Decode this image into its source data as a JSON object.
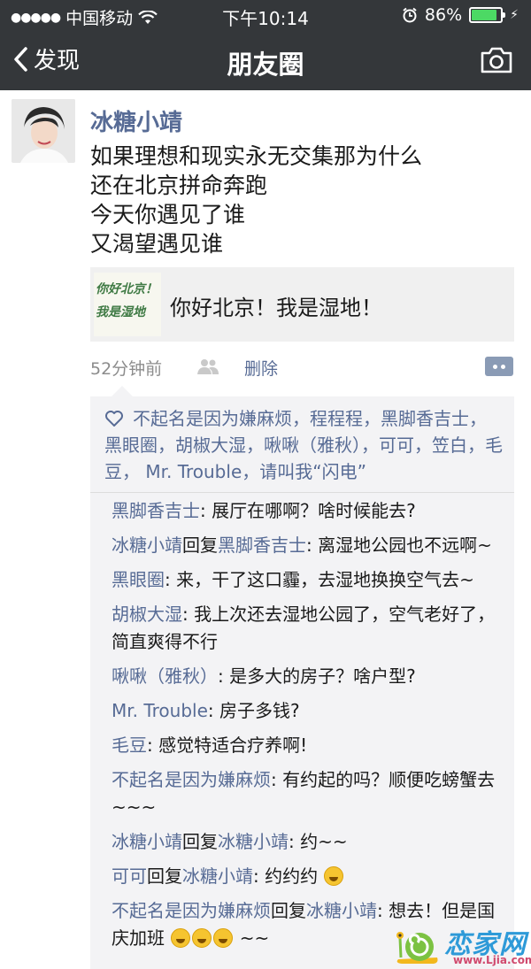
{
  "status_bar": {
    "carrier": "中国移动",
    "time": "下午10:14",
    "battery": "86%",
    "battery_level": 0.86
  },
  "navbar": {
    "back_label": "发现",
    "title": "朋友圈",
    "camera_icon": "camera-icon"
  },
  "post": {
    "author": "冰糖小靖",
    "text_lines": [
      "如果理想和现实永无交集那为什么",
      "还在北京拼命奔跑",
      "今天你遇见了谁",
      "又渴望遇见谁"
    ],
    "share": {
      "thumb_lines": [
        "你好北京！",
        "我是湿地"
      ],
      "title": "你好北京！我是湿地！"
    },
    "time": "52分钟前",
    "delete_label": "删除"
  },
  "likes": "不起名是因为嫌麻烦，程程程，黑脚香吉士，黑眼圈，胡椒大湿，啾啾（雅秋），可可，笠白，毛豆， Mr. Trouble，请叫我“闪电”",
  "comments": [
    {
      "from": "黑脚香吉士",
      "to": "",
      "text": "展厅在哪啊？啥时候能去?"
    },
    {
      "from": "冰糖小靖",
      "to": "黑脚香吉士",
      "text": "离湿地公园也不远啊~"
    },
    {
      "from": "黑眼圈",
      "to": "",
      "text": "来，干了这口霾，去湿地换换空气去~"
    },
    {
      "from": "胡椒大湿",
      "to": "",
      "text": "我上次还去湿地公园了，空气老好了，简直爽得不行"
    },
    {
      "from": "啾啾（雅秋）",
      "to": "",
      "text": "是多大的房子？啥户型?"
    },
    {
      "from": "Mr. Trouble",
      "to": "",
      "text": "房子多钱?"
    },
    {
      "from": "毛豆",
      "to": "",
      "text": "感觉特适合疗养啊!"
    },
    {
      "from": "不起名是因为嫌麻烦",
      "to": "",
      "text": "有约起的吗？顺便吃螃蟹去~~~"
    },
    {
      "from": "冰糖小靖",
      "to": "冰糖小靖",
      "text": "约~~"
    },
    {
      "from": "可可",
      "to": "冰糖小靖",
      "text": "约约约"
    },
    {
      "from": "不起名是因为嫌麻烦",
      "to": "冰糖小靖",
      "text": "想去！但是国庆加班"
    }
  ],
  "reply_word": "回复",
  "last_comment_suffix": "~~",
  "watermark": {
    "brand": "恋家网",
    "url": "www.Ljia.com"
  },
  "colors": {
    "nav_bg": "#34373a",
    "link_blue": "#576b95",
    "feedback_bg": "#f3f3f5"
  }
}
